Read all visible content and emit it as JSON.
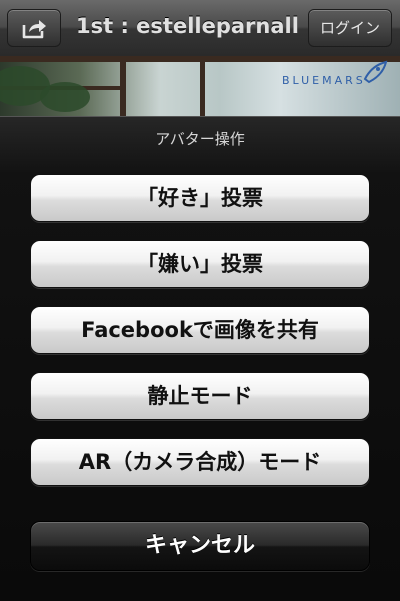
{
  "navbar": {
    "share_icon": "share-icon",
    "title": "1st : estelleparnall",
    "login_label": "ログイン"
  },
  "background": {
    "brand_text": "BLUEMARS"
  },
  "action_sheet": {
    "title": "アバター操作",
    "buttons": [
      {
        "label": "「好き」投票"
      },
      {
        "label": "「嫌い」投票"
      },
      {
        "label": "Facebookで画像を共有"
      },
      {
        "label": "静止モード"
      },
      {
        "label": "AR（カメラ合成）モード"
      }
    ],
    "cancel_label": "キャンセル"
  },
  "colors": {
    "sheet_background": "#0a0a0a",
    "button_face": "#e8e8e8",
    "cancel_face": "#1a1a1a",
    "brand_blue": "#2f5fa8"
  }
}
